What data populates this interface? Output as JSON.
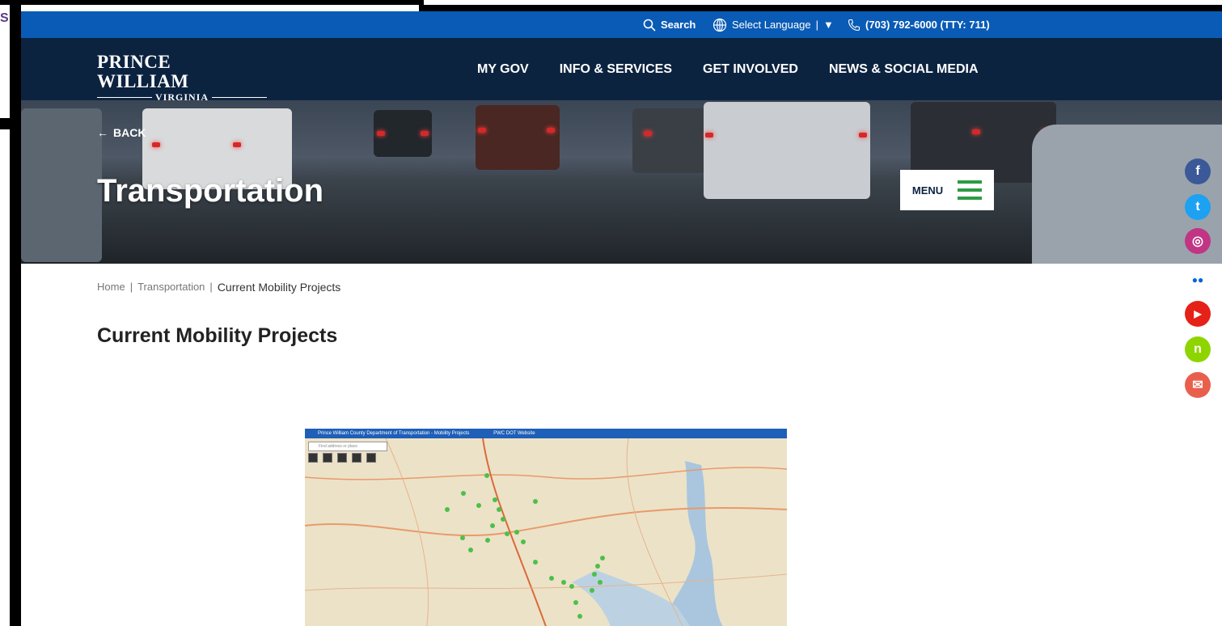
{
  "corner_letter": "S",
  "utility": {
    "search_label": "Search",
    "language_label": "Select Language",
    "language_divider": "|",
    "language_arrow": "▼",
    "phone": "(703) 792-6000 (TTY: 711)"
  },
  "logo": {
    "top": "PRINCE WILLIAM",
    "bottom": "VIRGINIA"
  },
  "nav": {
    "items": [
      {
        "label": "MY GOV"
      },
      {
        "label": "INFO & SERVICES"
      },
      {
        "label": "GET INVOLVED"
      },
      {
        "label": "NEWS & SOCIAL MEDIA"
      }
    ]
  },
  "hero": {
    "back_label": "BACK",
    "title": "Transportation",
    "menu_label": "MENU"
  },
  "breadcrumb": {
    "items": [
      "Home",
      "Transportation"
    ],
    "separator": "|",
    "current": "Current Mobility Projects"
  },
  "main": {
    "heading": "Current Mobility Projects"
  },
  "map": {
    "title": "Prince William County Department of Transportation - Mobility Projects",
    "subtitle": "PWC DOT Website",
    "search_placeholder": "Find address or place"
  },
  "social": [
    {
      "icon": "facebook-icon",
      "glyph": "f",
      "color": "#3b5998"
    },
    {
      "icon": "twitter-icon",
      "glyph": "t",
      "color": "#1da1f2"
    },
    {
      "icon": "instagram-icon",
      "glyph": "◎",
      "color": "#c13584"
    },
    {
      "icon": "flickr-icon",
      "glyph": "●●",
      "color": "#ffffff"
    },
    {
      "icon": "youtube-icon",
      "glyph": "▶",
      "color": "#e62117"
    },
    {
      "icon": "nextdoor-icon",
      "glyph": "n",
      "color": "#8ed500"
    },
    {
      "icon": "email-icon",
      "glyph": "✉",
      "color": "#e8604c"
    }
  ],
  "colors": {
    "utility_bar": "#0a5bb5",
    "nav_bar": "#0c2340",
    "menu_accent": "#2e9b43"
  }
}
